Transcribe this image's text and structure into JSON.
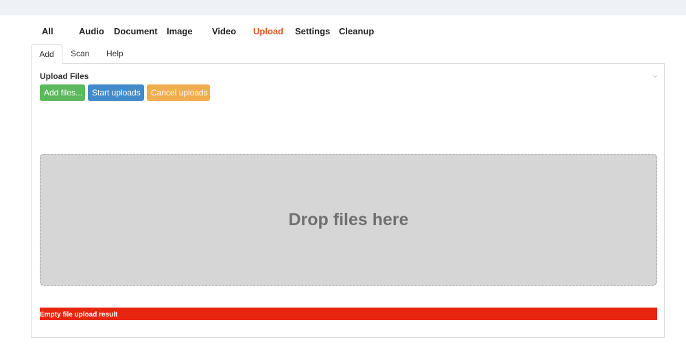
{
  "main_nav": {
    "items": [
      {
        "label": "All",
        "active": false
      },
      {
        "label": "Audio",
        "active": false
      },
      {
        "label": "Document",
        "active": false
      },
      {
        "label": "Image",
        "active": false
      },
      {
        "label": "Video",
        "active": false
      },
      {
        "label": "Upload",
        "active": true
      },
      {
        "label": "Settings",
        "active": false
      },
      {
        "label": "Cleanup",
        "active": false
      }
    ],
    "active_color": "#e8511e"
  },
  "sub_tabs": {
    "items": [
      {
        "label": "Add",
        "active": true
      },
      {
        "label": "Scan",
        "active": false
      },
      {
        "label": "Help",
        "active": false
      }
    ]
  },
  "upload_panel": {
    "title": "Upload Files",
    "buttons": {
      "add_files": "Add files...",
      "start_uploads": "Start uploads",
      "cancel_uploads": "Cancel uploads"
    },
    "dropzone_text": "Drop files here",
    "result_message": "Empty file upload result"
  },
  "colors": {
    "add_button": "#5cb85c",
    "start_button": "#428bca",
    "cancel_button": "#f0ad4e",
    "error_bar": "#e8250e",
    "dropzone": "#d6d6d6"
  },
  "icons": {
    "panel_collapse": "chevron-down-icon"
  }
}
